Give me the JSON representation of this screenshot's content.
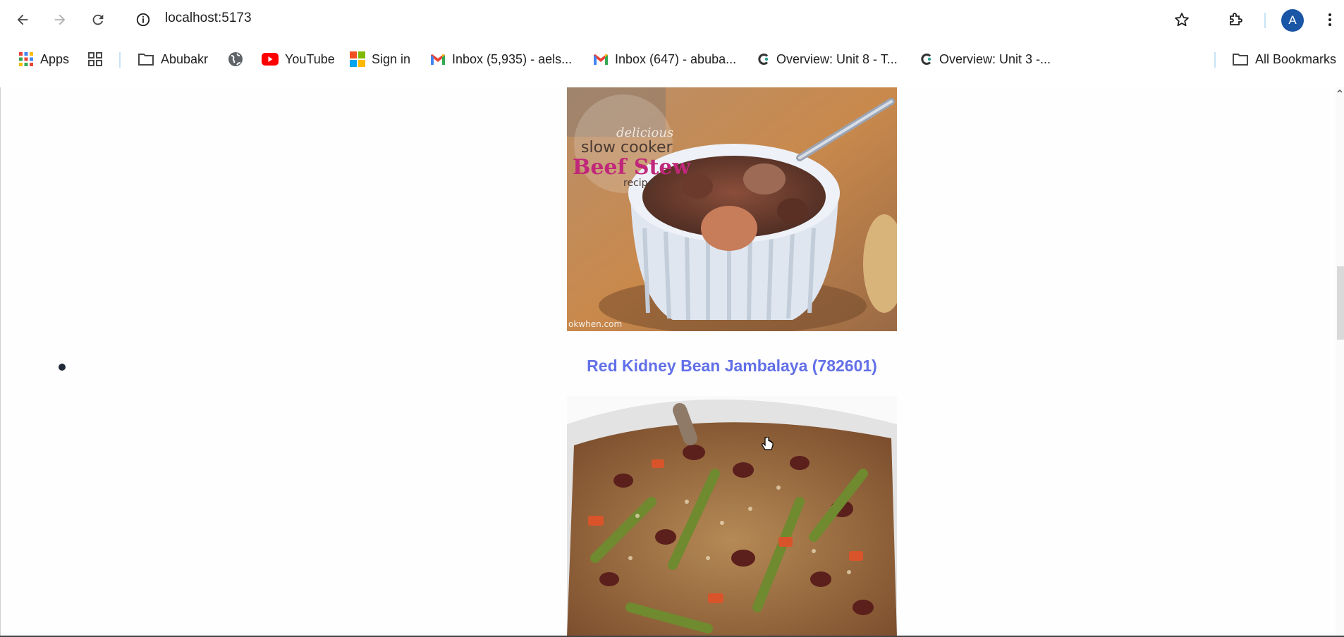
{
  "browser": {
    "url": "localhost:5173",
    "avatar_letter": "A"
  },
  "bookmarks": {
    "apps": "Apps",
    "folder1": "Abubakr",
    "youtube": "YouTube",
    "signin": "Sign in",
    "inbox1": "Inbox (5,935) - aels...",
    "inbox2": "Inbox (647) - abuba...",
    "overview1": "Overview: Unit 8 - T...",
    "overview2": "Overview: Unit 3 -...",
    "all": "All Bookmarks"
  },
  "recipes": {
    "first_image_text_1": "delicious",
    "first_image_text_2": "slow cooker",
    "first_image_text_3": "Beef Stew",
    "first_image_text_4": "recipe",
    "first_image_watermark": "okwhen.com",
    "second_title": "Red Kidney Bean Jambalaya (782601)"
  },
  "colors": {
    "link": "#6270e8",
    "avatar": "#1a56a5"
  }
}
